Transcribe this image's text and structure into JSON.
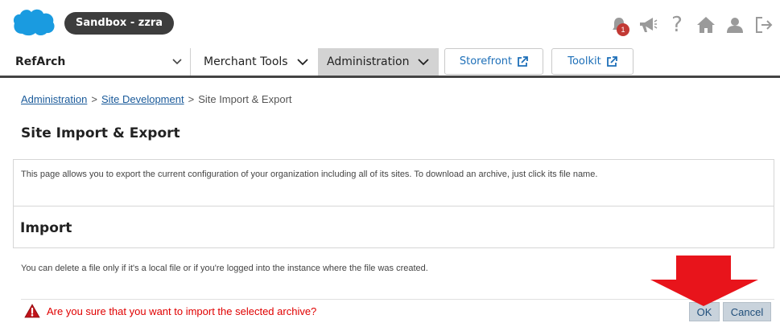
{
  "header": {
    "sandbox_label": "Sandbox - zzra",
    "notification_count": "1",
    "help_glyph": "?",
    "icons": [
      "salesforce-cloud-logo",
      "bell-icon",
      "megaphone-icon",
      "help-icon",
      "home-icon",
      "user-icon",
      "logout-icon"
    ]
  },
  "nav": {
    "site": "RefArch",
    "merchant_tools": "Merchant Tools",
    "administration": "Administration",
    "storefront": "Storefront",
    "toolkit": "Toolkit"
  },
  "breadcrumb": {
    "item1": "Administration",
    "item2": "Site Development",
    "item3": "Site Import & Export",
    "separator": ">"
  },
  "page": {
    "title": "Site Import & Export",
    "info": "This page allows you to export the current configuration of your organization including all of its sites. To download an archive, just click its file name.",
    "import_title": "Import",
    "delete_note": "You can delete a file only if it's a local file or if you're logged into the instance where the file was created.",
    "confirm_question": "Are you sure that you want to import the selected archive?",
    "ok_label": "OK",
    "cancel_label": "Cancel"
  },
  "colors": {
    "brand_blue": "#1a9be0",
    "alert_red": "#e00000",
    "arrow_red": "#e8141b",
    "link_blue": "#1a5a9a"
  }
}
